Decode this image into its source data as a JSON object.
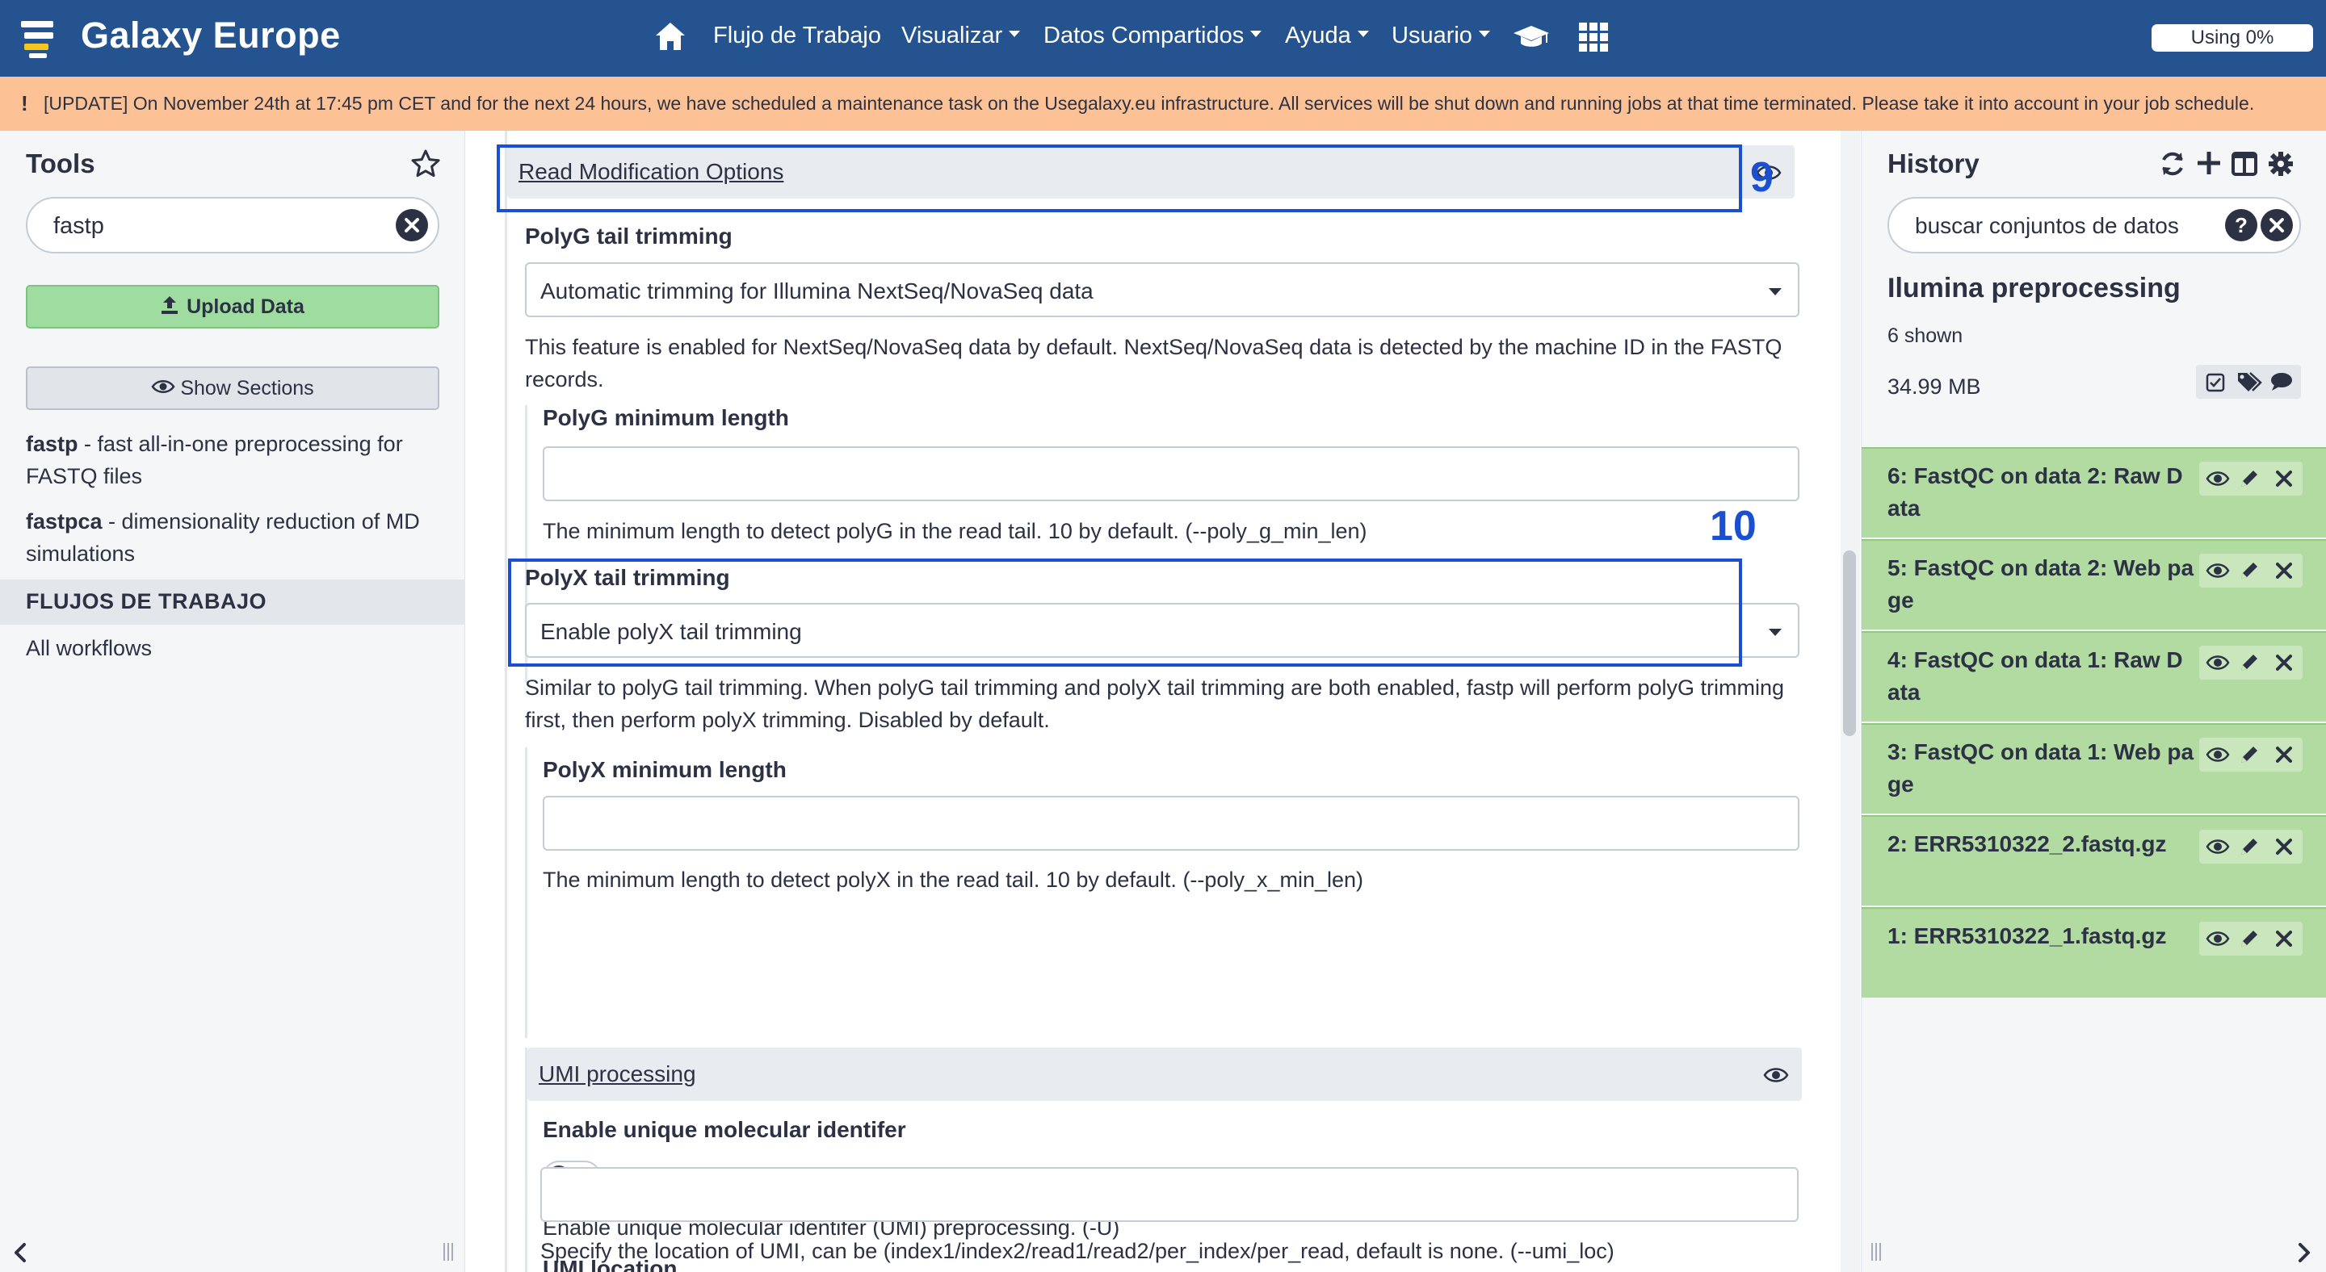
{
  "navbar": {
    "brand": "Galaxy Europe",
    "items": [
      {
        "label": "Flujo de Trabajo",
        "dropdown": false
      },
      {
        "label": "Visualizar",
        "dropdown": true
      },
      {
        "label": "Datos Compartidos",
        "dropdown": true
      },
      {
        "label": "Ayuda",
        "dropdown": true
      },
      {
        "label": "Usuario",
        "dropdown": true
      }
    ],
    "icons": [
      "home-icon",
      "graduation-cap-icon",
      "apps-grid-icon"
    ],
    "quota": "Using 0%",
    "color": "#25538f"
  },
  "banner": {
    "icon": "!",
    "text": "[UPDATE] On November 24th at 17:45 pm CET and for the next 24 hours, we have scheduled a maintenance task on the Usegalaxy.eu infrastructure. All services will be shut down and running jobs at that time terminated. Please take it into account in your job schedule.",
    "color": "#fcc295"
  },
  "tools": {
    "title": "Tools",
    "search_value": "fastp",
    "upload_label": "Upload Data",
    "sections_label": "Show Sections",
    "results": [
      {
        "name": "fastp",
        "desc": " - fast all-in-one preprocessing for FASTQ files"
      },
      {
        "name": "fastpca",
        "desc": " - dimensionality reduction of MD simulations"
      }
    ],
    "workflows_header": "FLUJOS DE TRABAJO",
    "all_workflows": "All workflows"
  },
  "form": {
    "read_mod": {
      "title": "Read Modification Options"
    },
    "polyg": {
      "label": "PolyG tail trimming",
      "value": "Automatic trimming for Illumina NextSeq/NovaSeq data",
      "help": "This feature is enabled for NextSeq/NovaSeq data by default. NextSeq/NovaSeq data is detected by the machine ID in the FASTQ records."
    },
    "polyg_min": {
      "label": "PolyG minimum length",
      "value": "",
      "help": "The minimum length to detect polyG in the read tail. 10 by default. (--poly_g_min_len)"
    },
    "polyx": {
      "label": "PolyX tail trimming",
      "value": "Enable polyX tail trimming",
      "help": "Similar to polyG tail trimming. When polyG tail trimming and polyX tail trimming are both enabled, fastp will perform polyG trimming first, then perform polyX trimming. Disabled by default."
    },
    "polyx_min": {
      "label": "PolyX minimum length",
      "value": "",
      "help": "The minimum length to detect polyX in the read tail. 10 by default. (--poly_x_min_len)"
    },
    "umi": {
      "title": "UMI processing"
    },
    "umi_enable": {
      "label": "Enable unique molecular identifer",
      "toggle_value": "No",
      "help": "Enable unique molecular identifer (UMI) preprocessing. (-U)"
    },
    "umi_loc": {
      "label": "UMI location",
      "value": "",
      "help": "Specify the location of UMI, can be (index1/index2/read1/read2/per_index/per_read, default is none. (--umi_loc)"
    },
    "annotations": {
      "first": "9",
      "second": "10",
      "color": "#1a4fd1"
    }
  },
  "history": {
    "title": "History",
    "search_placeholder": "buscar conjuntos de datos",
    "name": "Ilumina preprocessing",
    "shown": "6 shown",
    "size": "34.99 MB",
    "datasets": [
      {
        "label": "6: FastQC on data 2: Raw Data"
      },
      {
        "label": "5: FastQC on data 2: Web page"
      },
      {
        "label": "4: FastQC on data 1: Raw Data"
      },
      {
        "label": "3: FastQC on data 1: Web page"
      },
      {
        "label": "2: ERR5310322_2.fastq.gz"
      },
      {
        "label": "1: ERR5310322_1.fastq.gz"
      }
    ],
    "ok_color": "#b2dba1"
  }
}
